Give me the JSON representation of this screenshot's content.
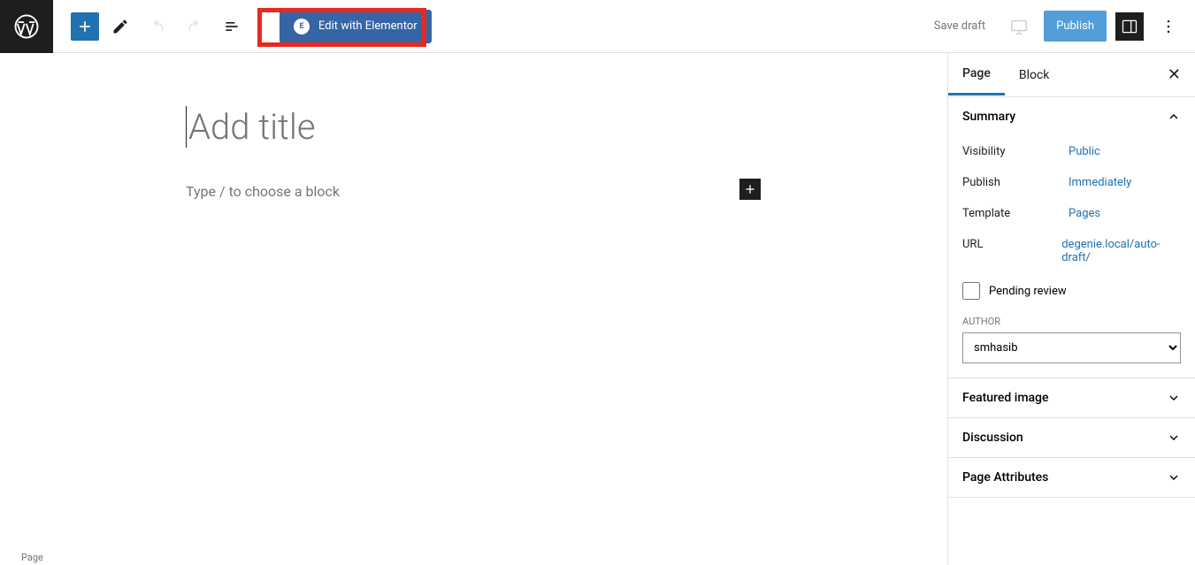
{
  "toolbar": {
    "elementor_label": "Edit with Elementor",
    "save_draft_label": "Save draft",
    "publish_label": "Publish"
  },
  "editor": {
    "title_placeholder": "Add title",
    "block_prompt": "Type / to choose a block"
  },
  "sidebar": {
    "tabs": {
      "page": "Page",
      "block": "Block"
    },
    "summary": {
      "title": "Summary",
      "visibility_label": "Visibility",
      "visibility_value": "Public",
      "publish_label": "Publish",
      "publish_value": "Immediately",
      "template_label": "Template",
      "template_value": "Pages",
      "url_label": "URL",
      "url_value": "degenie.local/auto-draft/",
      "pending_review_label": "Pending review",
      "author_label": "AUTHOR",
      "author_value": "smhasib"
    },
    "featured_image": "Featured image",
    "discussion": "Discussion",
    "page_attributes": "Page Attributes"
  },
  "footer": "Page"
}
